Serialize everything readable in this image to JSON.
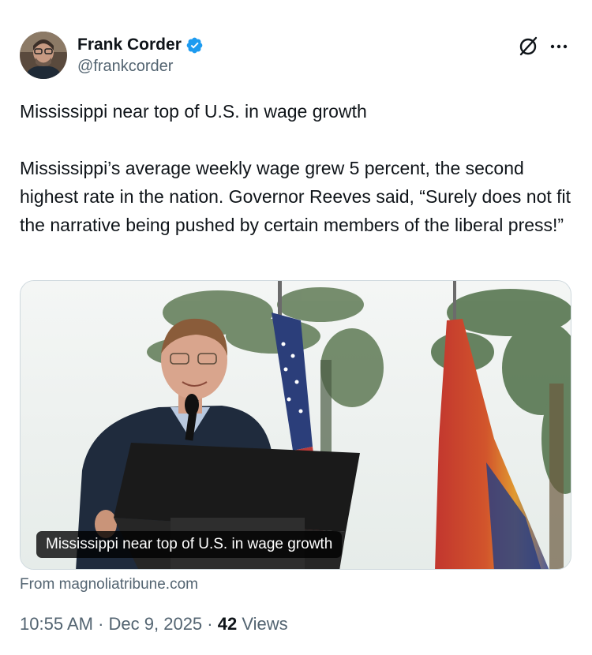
{
  "tweet": {
    "author": {
      "display_name": "Frank Corder",
      "handle": "@frankcorder",
      "verified_icon": "verified-badge-icon",
      "accent": "#1d9bf0"
    },
    "actions": {
      "grok_icon": "grok-icon",
      "more_icon": "more-options-icon"
    },
    "text_line1": "Mississippi near top of U.S. in wage growth",
    "text_paragraph": "Mississippi’s average weekly wage grew 5 percent, the second highest rate in the nation. Governor Reeves said, “Surely does not fit the narrative being pushed by certain members of the liberal press!”",
    "card": {
      "caption": "Mississippi near top of U.S. in wage growth",
      "source": "From magnoliatribune.com"
    },
    "meta": {
      "time": "10:55 AM",
      "separator": "·",
      "date": "Dec 9, 2025",
      "views_count": "42",
      "views_label": "Views"
    }
  }
}
